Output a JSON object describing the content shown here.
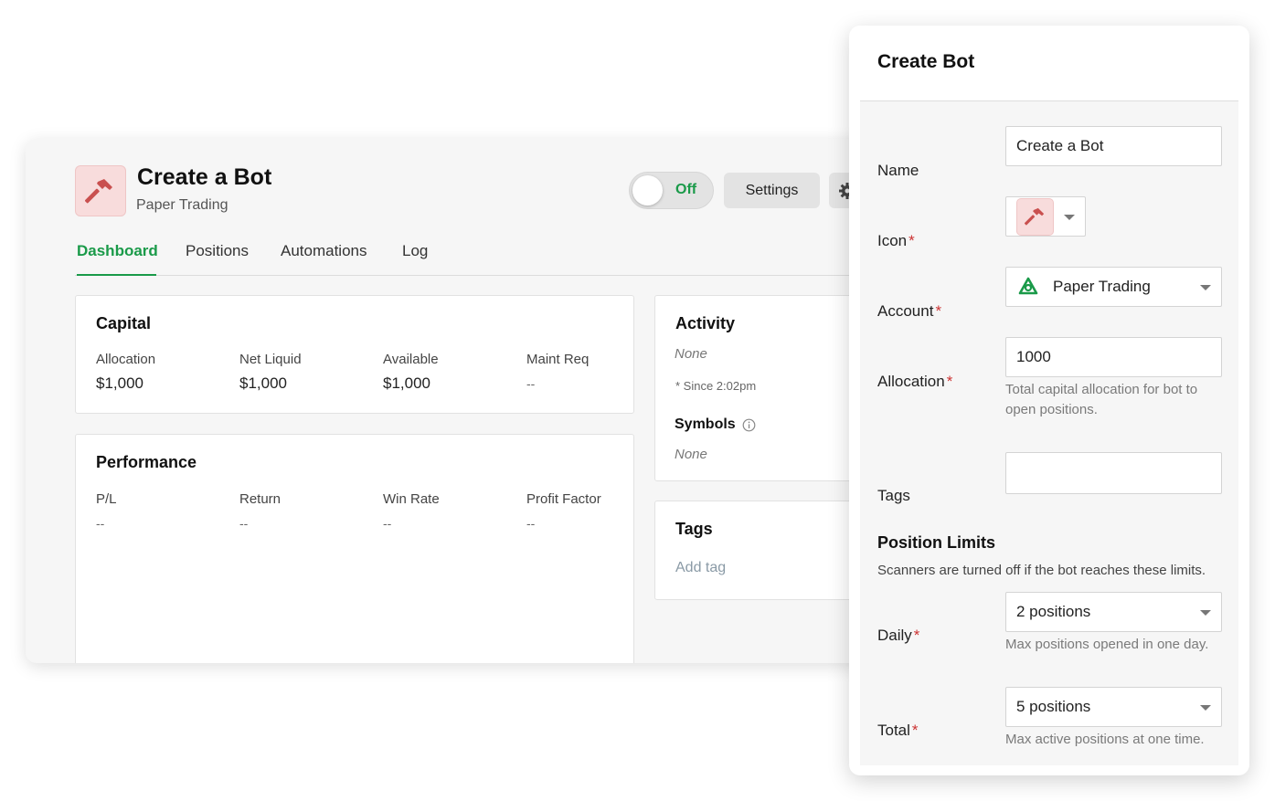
{
  "bot": {
    "title": "Create a Bot",
    "subtitle": "Paper Trading",
    "icon": "hammer-icon",
    "toggle_label": "Off",
    "settings_label": "Settings",
    "tabs": [
      "Dashboard",
      "Positions",
      "Automations",
      "Log"
    ],
    "active_tab": "Dashboard"
  },
  "capital": {
    "title": "Capital",
    "stats": [
      {
        "label": "Allocation",
        "value": "$1,000"
      },
      {
        "label": "Net Liquid",
        "value": "$1,000"
      },
      {
        "label": "Available",
        "value": "$1,000"
      },
      {
        "label": "Maint Req",
        "value": "--"
      }
    ]
  },
  "performance": {
    "title": "Performance",
    "stats": [
      {
        "label": "P/L",
        "value": "--"
      },
      {
        "label": "Return",
        "value": "--"
      },
      {
        "label": "Win Rate",
        "value": "--"
      },
      {
        "label": "Profit Factor",
        "value": "--"
      }
    ]
  },
  "activity": {
    "title": "Activity",
    "value": "None",
    "since": "* Since 2:02pm",
    "symbols_title": "Symbols",
    "symbols_value": "None"
  },
  "tags_card": {
    "title": "Tags",
    "add_label": "Add tag"
  },
  "modal": {
    "title": "Create Bot",
    "name_label": "Name",
    "name_value": "Create a Bot",
    "icon_label": "Icon",
    "account_label": "Account",
    "account_value": "Paper Trading",
    "allocation_label": "Allocation",
    "allocation_value": "1000",
    "allocation_help": "Total capital allocation for bot to open positions.",
    "tags_label": "Tags",
    "tags_value": "",
    "limits_title": "Position Limits",
    "limits_desc": "Scanners are turned off if the bot reaches these limits.",
    "daily_label": "Daily",
    "daily_value": "2 positions",
    "daily_help": "Max positions opened in one day.",
    "total_label": "Total",
    "total_value": "5 positions",
    "total_help": "Max active positions at one time.",
    "required_mark": "*"
  },
  "colors": {
    "accent": "#1a9a49",
    "required": "#cc3333",
    "hammer": "#c9504f"
  }
}
